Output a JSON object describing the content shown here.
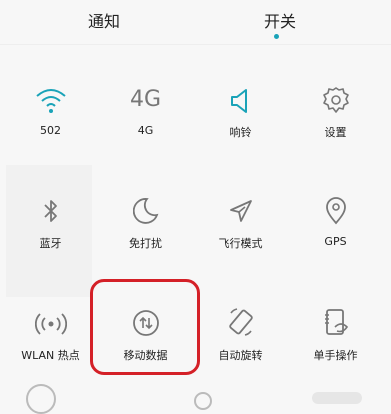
{
  "tabs": {
    "notification_label": "通知",
    "switches_label": "开关"
  },
  "toggles": [
    {
      "label": "502",
      "icon": "wifi-icon",
      "active": true
    },
    {
      "label": "4G",
      "icon": "4g-icon",
      "icon_text": "4G",
      "active": false
    },
    {
      "label": "响铃",
      "icon": "speaker-icon",
      "active": true
    },
    {
      "label": "设置",
      "icon": "gear-icon",
      "active": false
    },
    {
      "label": "蓝牙",
      "icon": "bluetooth-icon",
      "active": false
    },
    {
      "label": "免打扰",
      "icon": "moon-icon",
      "active": false
    },
    {
      "label": "飞行模式",
      "icon": "airplane-icon",
      "active": false
    },
    {
      "label": "GPS",
      "icon": "location-pin-icon",
      "active": false
    },
    {
      "label": "WLAN 热点",
      "icon": "hotspot-icon",
      "active": false
    },
    {
      "label": "移动数据",
      "icon": "mobile-data-icon",
      "active": false
    },
    {
      "label": "自动旋转",
      "icon": "rotate-icon",
      "active": false
    },
    {
      "label": "单手操作",
      "icon": "one-hand-icon",
      "active": false
    }
  ],
  "colors": {
    "accent": "#1aa3b8",
    "highlight": "#d42027"
  }
}
